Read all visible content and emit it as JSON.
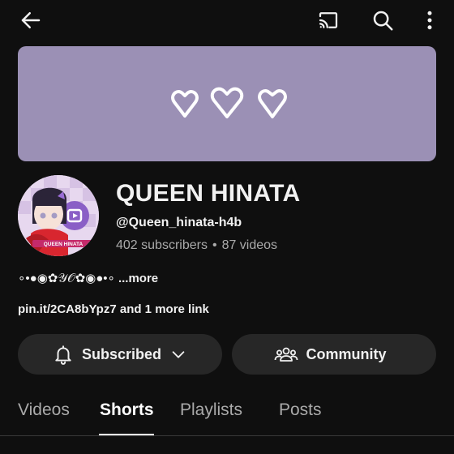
{
  "topbar": {
    "icons": [
      "back-arrow-icon",
      "cast-icon",
      "search-icon",
      "more-vertical-icon"
    ]
  },
  "banner": {
    "color": "#9b90b5",
    "icons": [
      "heart-icon",
      "heart-icon",
      "heart-icon"
    ]
  },
  "channel": {
    "name": "QUEEN HINATA",
    "handle": "@Queen_hinata-h4b",
    "subscribers": "402 subscribers",
    "separator": "•",
    "videos": "87 videos",
    "avatar_caption": "QUEEN HINATA"
  },
  "description": {
    "text": "∘•●◉✿𝒴𝒪✿◉●•∘",
    "more_label": "...more"
  },
  "links": {
    "text": "pin.it/2CA8bYpz7 and 1 more link"
  },
  "buttons": {
    "subscribed_label": "Subscribed",
    "community_label": "Community"
  },
  "tabs": [
    {
      "label": "Videos",
      "active": false
    },
    {
      "label": "Shorts",
      "active": true
    },
    {
      "label": "Playlists",
      "active": false
    },
    {
      "label": "Posts",
      "active": false
    }
  ],
  "colors": {
    "background": "#0f0f0f",
    "pill": "#272727",
    "secondary_text": "#aaaaaa"
  }
}
